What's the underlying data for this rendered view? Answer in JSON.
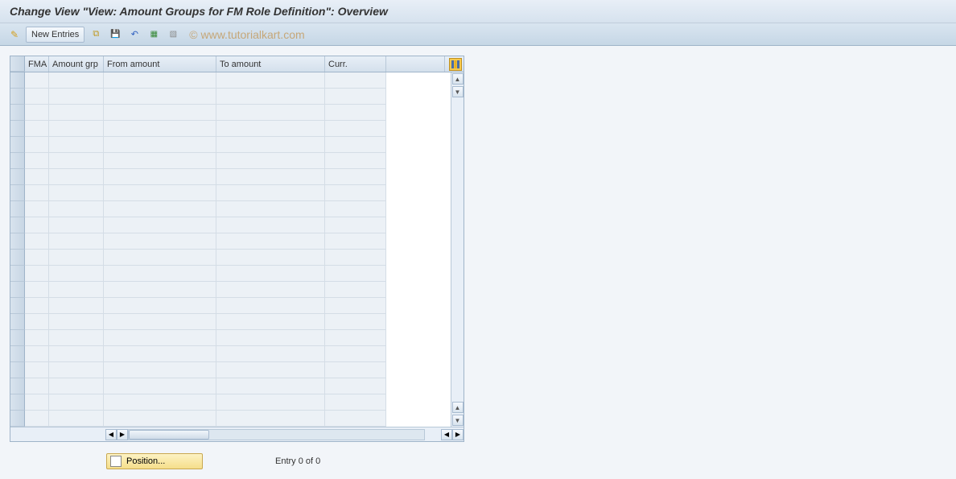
{
  "title": "Change View \"View: Amount Groups for FM Role Definition\": Overview",
  "toolbar": {
    "new_entries_label": "New Entries"
  },
  "watermark": "© www.tutorialkart.com",
  "table": {
    "columns": {
      "fma": "FMA",
      "amount_grp": "Amount grp",
      "from_amount": "From amount",
      "to_amount": "To amount",
      "curr": "Curr."
    },
    "rows": []
  },
  "footer": {
    "position_label": "Position...",
    "entry_text": "Entry 0 of 0"
  }
}
